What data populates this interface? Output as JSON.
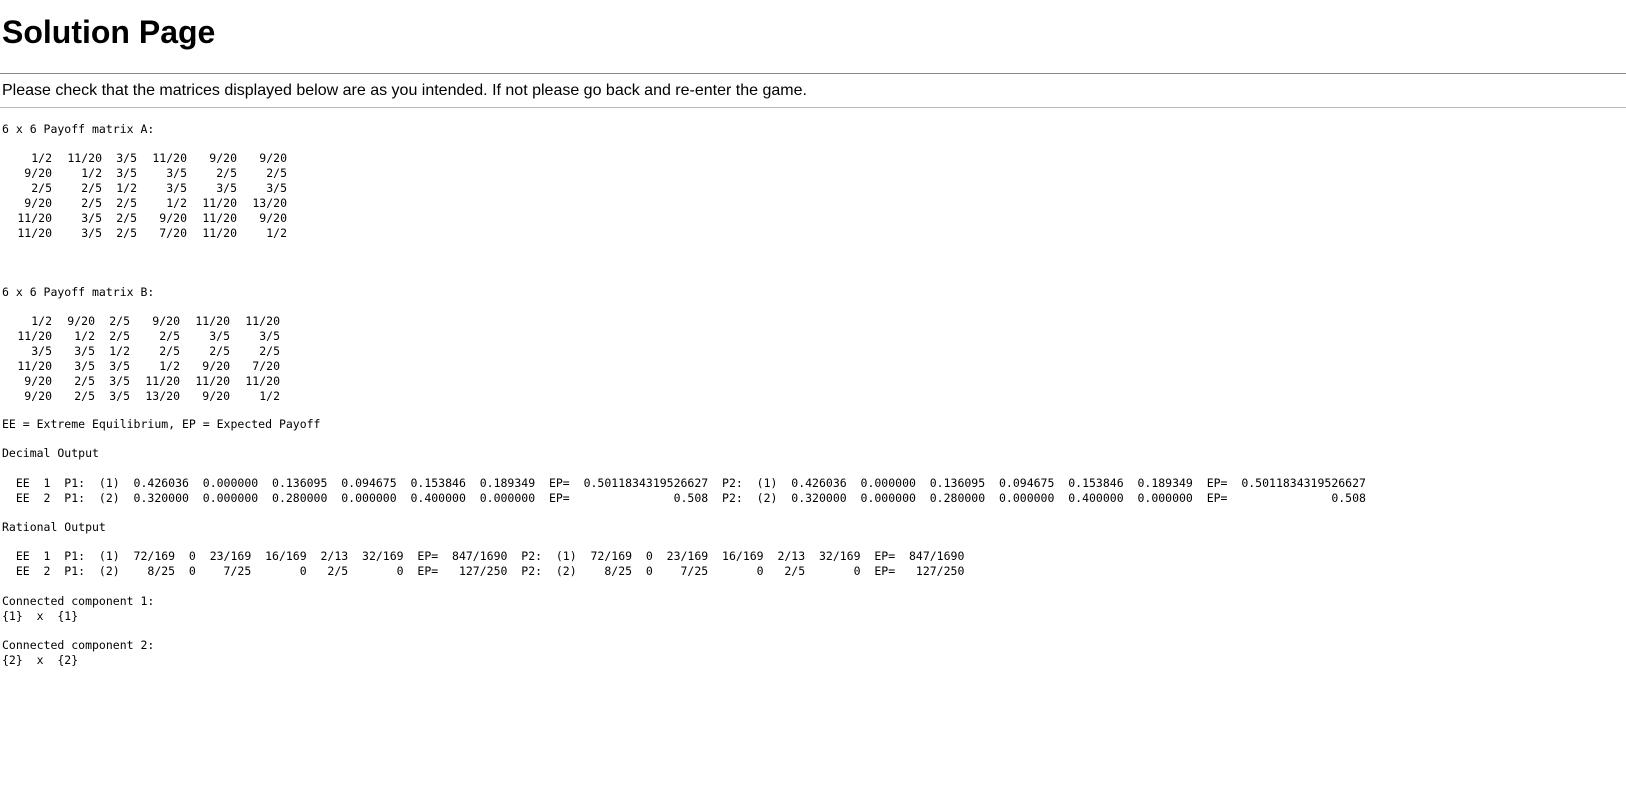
{
  "title": "Solution Page",
  "intro": "Please check that the matrices displayed below are as you intended. If not please go back and re-enter the game.",
  "matrixA": {
    "label": "6 x 6 Payoff matrix A:",
    "rows": [
      [
        "1/2",
        "11/20",
        "3/5",
        "11/20",
        "9/20",
        "9/20"
      ],
      [
        "9/20",
        "1/2",
        "3/5",
        "3/5",
        "2/5",
        "2/5"
      ],
      [
        "2/5",
        "2/5",
        "1/2",
        "3/5",
        "3/5",
        "3/5"
      ],
      [
        "9/20",
        "2/5",
        "2/5",
        "1/2",
        "11/20",
        "13/20"
      ],
      [
        "11/20",
        "3/5",
        "2/5",
        "9/20",
        "11/20",
        "9/20"
      ],
      [
        "11/20",
        "3/5",
        "2/5",
        "7/20",
        "11/20",
        "1/2"
      ]
    ]
  },
  "matrixB": {
    "label": "6 x 6 Payoff matrix B:",
    "rows": [
      [
        "1/2",
        "9/20",
        "2/5",
        "9/20",
        "11/20",
        "11/20"
      ],
      [
        "11/20",
        "1/2",
        "2/5",
        "2/5",
        "3/5",
        "3/5"
      ],
      [
        "3/5",
        "3/5",
        "1/2",
        "2/5",
        "2/5",
        "2/5"
      ],
      [
        "11/20",
        "3/5",
        "3/5",
        "1/2",
        "9/20",
        "7/20"
      ],
      [
        "9/20",
        "2/5",
        "3/5",
        "11/20",
        "11/20",
        "11/20"
      ],
      [
        "9/20",
        "2/5",
        "3/5",
        "13/20",
        "9/20",
        "1/2"
      ]
    ]
  },
  "legend": "EE = Extreme Equilibrium, EP = Expected Payoff",
  "decimal": {
    "label": "Decimal Output",
    "lines": [
      "  EE  1  P1:  (1)  0.426036  0.000000  0.136095  0.094675  0.153846  0.189349  EP=  0.5011834319526627  P2:  (1)  0.426036  0.000000  0.136095  0.094675  0.153846  0.189349  EP=  0.5011834319526627",
      "  EE  2  P1:  (2)  0.320000  0.000000  0.280000  0.000000  0.400000  0.000000  EP=               0.508  P2:  (2)  0.320000  0.000000  0.280000  0.000000  0.400000  0.000000  EP=               0.508"
    ]
  },
  "rational": {
    "label": "Rational Output",
    "lines": [
      "  EE  1  P1:  (1)  72/169  0  23/169  16/169  2/13  32/169  EP=  847/1690  P2:  (1)  72/169  0  23/169  16/169  2/13  32/169  EP=  847/1690",
      "  EE  2  P1:  (2)    8/25  0    7/25       0   2/5       0  EP=   127/250  P2:  (2)    8/25  0    7/25       0   2/5       0  EP=   127/250"
    ]
  },
  "components": [
    {
      "label": "Connected component 1:",
      "value": "{1}  x  {1}"
    },
    {
      "label": "Connected component 2:",
      "value": "{2}  x  {2}"
    }
  ]
}
